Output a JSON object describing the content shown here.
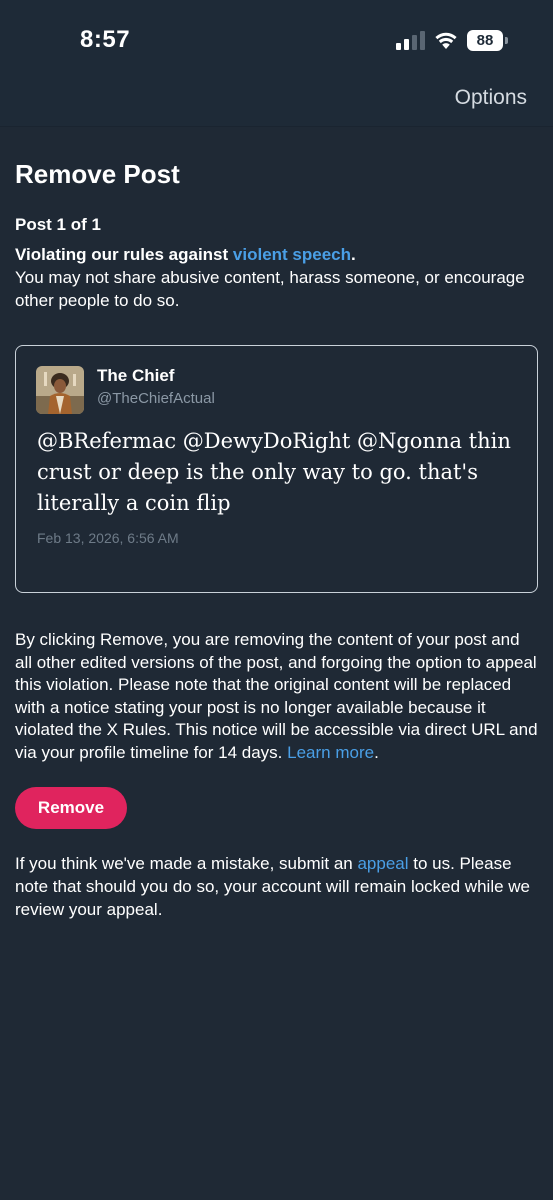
{
  "status_bar": {
    "time": "8:57",
    "battery": "88",
    "signal_icon": "cellular-signal-icon",
    "wifi_icon": "wifi-icon"
  },
  "nav": {
    "options_label": "Options"
  },
  "page": {
    "title": "Remove Post",
    "post_count": "Post 1 of 1",
    "violation_prefix": "Violating our rules against ",
    "violation_link": "violent speech",
    "violation_suffix": ".",
    "violation_desc": "You may not share abusive content, harass someone, or encourage other people to do so."
  },
  "tweet": {
    "display_name": "The Chief",
    "handle": "@TheChiefActual",
    "text": "@BRefermac @DewyDoRight @Ngonna thin crust or deep is the only way to go. that's literally a coin flip",
    "date": "Feb 13, 2026, 6:56 AM"
  },
  "notice": {
    "text": "By clicking Remove, you are removing the content of your post and all other edited versions of the post, and forgoing the option to appeal this violation. Please note that the original content will be replaced with a notice stating your post is no longer available because it violated the X Rules. This notice will be accessible via direct URL and via your profile timeline for 14 days. ",
    "learn_more": "Learn more",
    "suffix": "."
  },
  "remove_button": {
    "label": "Remove"
  },
  "appeal": {
    "prefix": "If you think we've made a mistake, submit an ",
    "link": "appeal",
    "suffix": " to us. Please note that should you do so, your account will remain locked while we review your appeal."
  },
  "colors": {
    "background": "#1f2935",
    "link": "#4a9fe6",
    "remove_button": "#e0245e"
  }
}
